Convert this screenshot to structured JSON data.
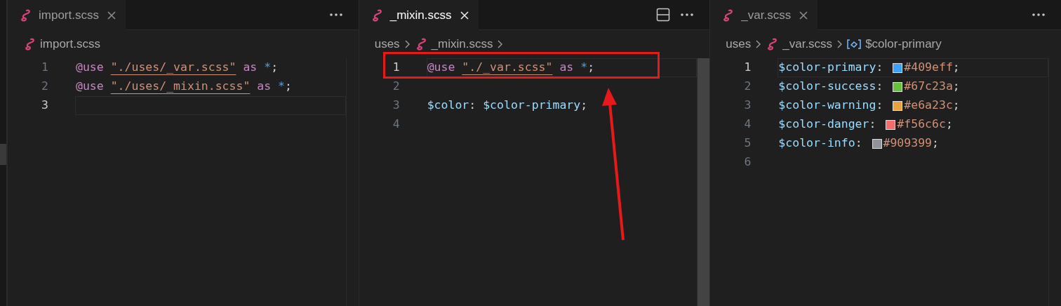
{
  "panes": [
    {
      "tab": {
        "label": "import.scss",
        "selected": false
      },
      "breadcrumb": [
        {
          "kind": "file",
          "text": "import.scss"
        }
      ],
      "lines": [
        {
          "number": "1",
          "current": false,
          "tokens": [
            {
              "kind": "at",
              "text": "@use "
            },
            {
              "kind": "string",
              "text": "\"./uses/_var.scss\""
            },
            {
              "kind": "keyword",
              "text": " as "
            },
            {
              "kind": "operator",
              "text": "*"
            },
            {
              "kind": "punct",
              "text": ";"
            }
          ]
        },
        {
          "number": "2",
          "current": false,
          "tokens": [
            {
              "kind": "at",
              "text": "@use "
            },
            {
              "kind": "string",
              "text": "\"./uses/_mixin.scss\""
            },
            {
              "kind": "keyword",
              "text": " as "
            },
            {
              "kind": "operator",
              "text": "*"
            },
            {
              "kind": "punct",
              "text": ";"
            }
          ]
        },
        {
          "number": "3",
          "current": true
        }
      ]
    },
    {
      "tab": {
        "label": "_mixin.scss",
        "selected": true
      },
      "breadcrumb": [
        {
          "kind": "folder",
          "text": "uses"
        },
        {
          "kind": "file",
          "text": "_mixin.scss"
        }
      ],
      "lines": [
        {
          "number": "1",
          "current": true,
          "annotated": true,
          "tokens": [
            {
              "kind": "at",
              "text": "@use "
            },
            {
              "kind": "string",
              "text": "\"./_var.scss\""
            },
            {
              "kind": "keyword",
              "text": " as "
            },
            {
              "kind": "operator",
              "text": "*"
            },
            {
              "kind": "punct",
              "text": ";"
            }
          ]
        },
        {
          "number": "2",
          "current": false
        },
        {
          "number": "3",
          "current": false,
          "tokens": [
            {
              "kind": "variable",
              "text": "$color"
            },
            {
              "kind": "punct",
              "text": ": "
            },
            {
              "kind": "variable",
              "text": "$color-primary"
            },
            {
              "kind": "punct",
              "text": ";"
            }
          ]
        },
        {
          "number": "4",
          "current": false
        }
      ]
    },
    {
      "tab": {
        "label": "_var.scss",
        "selected": false
      },
      "breadcrumb": [
        {
          "kind": "folder",
          "text": "uses"
        },
        {
          "kind": "file",
          "text": "_var.scss"
        },
        {
          "kind": "symbol",
          "text": "$color-primary"
        }
      ],
      "lines": [
        {
          "number": "1",
          "current": true,
          "tokens": [
            {
              "kind": "variable",
              "text": "$color-primary"
            },
            {
              "kind": "punct",
              "text": ": "
            },
            {
              "kind": "swatch",
              "color": "#409eff"
            },
            {
              "kind": "value",
              "text": "#409eff"
            },
            {
              "kind": "punct",
              "text": ";"
            }
          ]
        },
        {
          "number": "2",
          "current": false,
          "tokens": [
            {
              "kind": "variable",
              "text": "$color-success"
            },
            {
              "kind": "punct",
              "text": ": "
            },
            {
              "kind": "swatch",
              "color": "#67c23a"
            },
            {
              "kind": "value",
              "text": "#67c23a"
            },
            {
              "kind": "punct",
              "text": ";"
            }
          ]
        },
        {
          "number": "3",
          "current": false,
          "tokens": [
            {
              "kind": "variable",
              "text": "$color-warning"
            },
            {
              "kind": "punct",
              "text": ": "
            },
            {
              "kind": "swatch",
              "color": "#e6a23c"
            },
            {
              "kind": "value",
              "text": "#e6a23c"
            },
            {
              "kind": "punct",
              "text": ";"
            }
          ]
        },
        {
          "number": "4",
          "current": false,
          "tokens": [
            {
              "kind": "variable",
              "text": "$color-danger"
            },
            {
              "kind": "punct",
              "text": ": "
            },
            {
              "kind": "swatch",
              "color": "#f56c6c"
            },
            {
              "kind": "value",
              "text": "#f56c6c"
            },
            {
              "kind": "punct",
              "text": ";"
            }
          ]
        },
        {
          "number": "5",
          "current": false,
          "tokens": [
            {
              "kind": "variable",
              "text": "$color-info"
            },
            {
              "kind": "punct",
              "text": ": "
            },
            {
              "kind": "swatch",
              "color": "#909399"
            },
            {
              "kind": "value",
              "text": "#909399"
            },
            {
              "kind": "punct",
              "text": ";"
            }
          ]
        },
        {
          "number": "6",
          "current": false
        }
      ]
    }
  ]
}
